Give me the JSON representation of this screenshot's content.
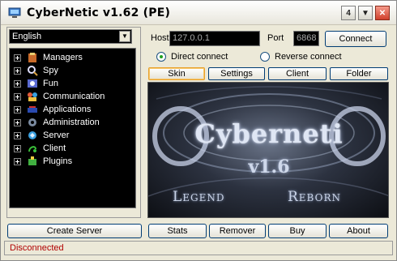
{
  "window": {
    "title": "CyberNetic v1.62 (PE)"
  },
  "titlebar_buttons": [
    "4",
    "▼",
    "✕"
  ],
  "language": {
    "selected": "English"
  },
  "tree": [
    {
      "label": "Managers",
      "icon": "managers-icon"
    },
    {
      "label": "Spy",
      "icon": "spy-icon"
    },
    {
      "label": "Fun",
      "icon": "fun-icon"
    },
    {
      "label": "Communication",
      "icon": "communication-icon"
    },
    {
      "label": "Applications",
      "icon": "applications-icon"
    },
    {
      "label": "Administration",
      "icon": "administration-icon"
    },
    {
      "label": "Server",
      "icon": "server-icon"
    },
    {
      "label": "Client",
      "icon": "client-icon"
    },
    {
      "label": "Plugins",
      "icon": "plugins-icon"
    }
  ],
  "connection": {
    "host_label": "Host",
    "host_value": "127.0.0.1",
    "port_label": "Port",
    "port_value": "6868",
    "connect_label": "Connect",
    "direct_label": "Direct connect",
    "reverse_label": "Reverse connect",
    "selected_mode": "Direct connect"
  },
  "tabs": [
    "Skin",
    "Settings",
    "Client",
    "Folder"
  ],
  "active_tab": "Skin",
  "banner": {
    "title": "Cyberneti",
    "version": "v1.6",
    "left_text": "Legend",
    "right_text": "Reborn"
  },
  "bottom_buttons": {
    "create_server": "Create Server",
    "stats": "Stats",
    "remover": "Remover",
    "buy": "Buy",
    "about": "About"
  },
  "status": {
    "text": "Disconnected",
    "color": "#b00000"
  },
  "colors": {
    "accent": "#003c74",
    "active_tab": "#e8a12c",
    "background": "#ece9d8"
  }
}
